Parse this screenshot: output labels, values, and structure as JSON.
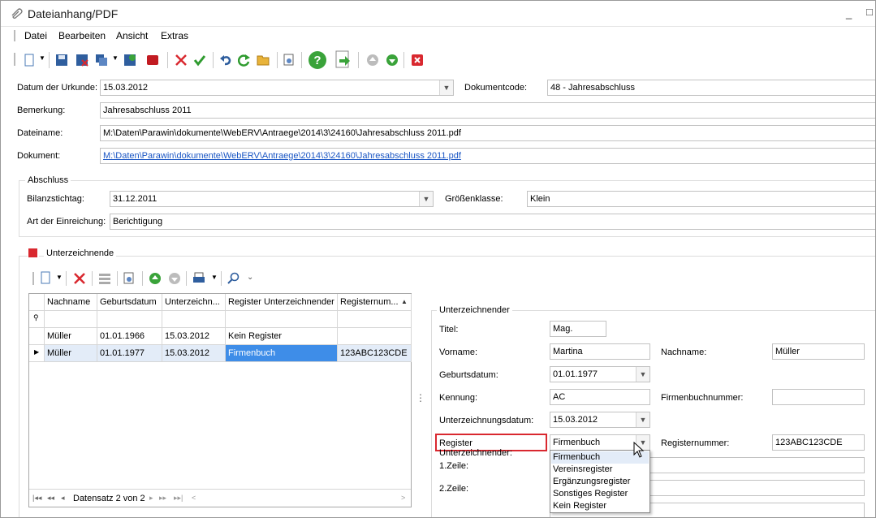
{
  "window": {
    "title": "Dateianhang/PDF",
    "minimize": "_",
    "maximize": "□"
  },
  "menu": [
    "Datei",
    "Bearbeiten",
    "Ansicht",
    "Extras"
  ],
  "toolbar_icons": [
    "new-icon",
    "save-icon",
    "save-close-icon",
    "copy-icon",
    "save-db-icon",
    "stop-icon",
    "delete-icon",
    "confirm-icon",
    "undo-icon",
    "refresh-icon",
    "open-folder-icon",
    "preview-icon",
    "help-icon",
    "export-icon",
    "move-up-icon",
    "move-down-icon",
    "close-icon"
  ],
  "form": {
    "datum_label": "Datum der Urkunde:",
    "datum_value": "15.03.2012",
    "dokumentcode_label": "Dokumentcode:",
    "dokumentcode_value": "48 - Jahresabschluss",
    "bemerkung_label": "Bemerkung:",
    "bemerkung_value": "Jahresabschluss 2011",
    "dateiname_label": "Dateiname:",
    "dateiname_value": "M:\\Daten\\Parawin\\dokumente\\WebERV\\Antraege\\2014\\3\\24160\\Jahresabschluss 2011.pdf",
    "dokument_label": "Dokument:",
    "dokument_value": "M:\\Daten\\Parawin\\dokumente\\WebERV\\Antraege\\2014\\3\\24160\\Jahresabschluss 2011.pdf"
  },
  "abschluss": {
    "title": "Abschluss",
    "bilanz_label": "Bilanzstichtag:",
    "bilanz_value": "31.12.2011",
    "groesse_label": "Größenklasse:",
    "groesse_value": "Klein",
    "art_label": "Art der Einreichung:",
    "art_value": "Berichtigung"
  },
  "unterzeichnende": {
    "title": "Unterzeichnende",
    "grid": {
      "columns": [
        "Nachname",
        "Geburtsdatum",
        "Unterzeichn...",
        "Register Unterzeichnender",
        "Registernum..."
      ],
      "rows": [
        [
          "Müller",
          "01.01.1966",
          "15.03.2012",
          "Kein Register",
          ""
        ],
        [
          "Müller",
          "01.01.1977",
          "15.03.2012",
          "Firmenbuch",
          "123ABC123CDE"
        ]
      ],
      "nav_text": "Datensatz 2 von 2"
    }
  },
  "detail": {
    "title": "Unterzeichnender",
    "titel_label": "Titel:",
    "titel_value": "Mag.",
    "vorname_label": "Vorname:",
    "vorname_value": "Martina",
    "nachname_label": "Nachname:",
    "nachname_value": "Müller",
    "geburtsdatum_label": "Geburtsdatum:",
    "geburtsdatum_value": "01.01.1977",
    "kennung_label": "Kennung:",
    "kennung_value": "AC",
    "firmenbuchnr_label": "Firmenbuchnummer:",
    "firmenbuchnr_value": "",
    "unterzeichnungsdatum_label": "Unterzeichnungsdatum:",
    "unterzeichnungsdatum_value": "15.03.2012",
    "register_label": "Register Unterzeichnender:",
    "register_value": "Firmenbuch",
    "registernummer_label": "Registernummer:",
    "registernummer_value": "123ABC123CDE",
    "zeile1_label": "1.Zeile:",
    "zeile2_label": "2.Zeile:",
    "register_options": [
      "Firmenbuch",
      "Vereinsregister",
      "Ergänzungsregister",
      "Sonstiges Register",
      "Kein Register"
    ]
  },
  "colors": {
    "highlight_red": "#d9282f",
    "selection_blue": "#3e8de8",
    "link": "#1a56c4"
  }
}
